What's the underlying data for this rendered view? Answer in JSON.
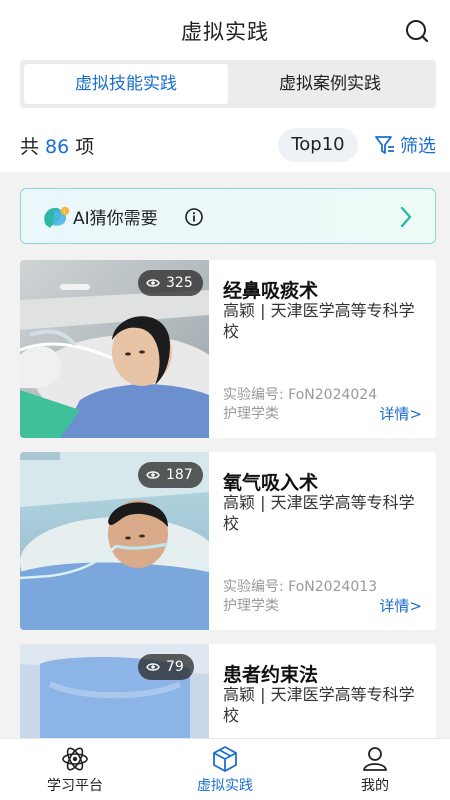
{
  "header": {
    "title": "虚拟实践",
    "search_icon": "search-icon"
  },
  "tabs": [
    {
      "label": "虚拟技能实践",
      "active": true
    },
    {
      "label": "虚拟案例实践",
      "active": false
    }
  ],
  "summary": {
    "prefix": "共",
    "count": "86",
    "suffix": "项",
    "top_label": "Top10",
    "filter_label": "筛选"
  },
  "ai_bar": {
    "text": "AI猜你需要",
    "logo_icon": "ai-logo-icon",
    "info_icon": "info-icon",
    "arrow_icon": "chevron-right-icon"
  },
  "cards": [
    {
      "views": "325",
      "title": "经鼻吸痰术",
      "school": "高颖 | 天津医学高等专科学校",
      "code": "实验编号: FoN2024024",
      "category": "护理学类",
      "detail": "详情>"
    },
    {
      "views": "187",
      "title": "氧气吸入术",
      "school": "高颖 | 天津医学高等专科学校",
      "code": "实验编号: FoN2024013",
      "category": "护理学类",
      "detail": "详情>"
    },
    {
      "views": "79",
      "title": "患者约束法",
      "school": "高颖 | 天津医学高等专科学校",
      "code": "",
      "category": "",
      "detail": ""
    }
  ],
  "nav": [
    {
      "label": "学习平台",
      "icon": "atom-icon",
      "active": false
    },
    {
      "label": "虚拟实践",
      "icon": "cube-icon",
      "active": true
    },
    {
      "label": "我的",
      "icon": "user-icon",
      "active": false
    }
  ],
  "colors": {
    "accent": "#1a6fd0",
    "ai_border": "#8fd7d0",
    "page_bg": "#f2f2f2"
  }
}
